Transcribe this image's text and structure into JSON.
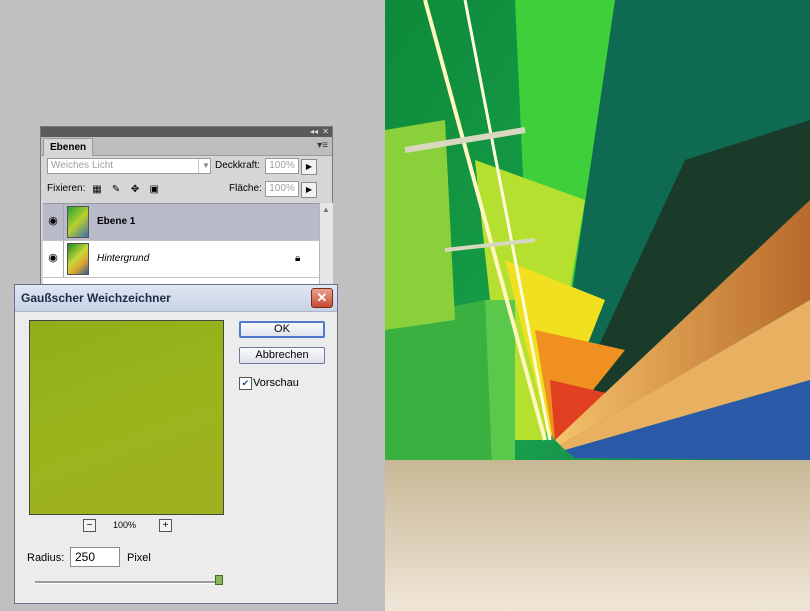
{
  "layers_panel": {
    "tab": "Ebenen",
    "menu_icon": "panel-menu-icon",
    "blend_mode": "Weiches Licht",
    "opacity_label": "Deckkraft:",
    "opacity_value": "100%",
    "lock_label": "Fixieren:",
    "fill_label": "Fläche:",
    "fill_value": "100%",
    "layers": [
      {
        "name": "Ebene 1",
        "selected": true,
        "locked": false
      },
      {
        "name": "Hintergrund",
        "selected": false,
        "locked": true
      }
    ]
  },
  "dialog": {
    "title": "Gaußscher Weichzeichner",
    "ok": "OK",
    "cancel": "Abbrechen",
    "preview_label": "Vorschau",
    "preview_checked": true,
    "zoom": "100%",
    "radius_label": "Radius:",
    "radius_value": "250",
    "radius_unit": "Pixel",
    "slider_level": 0.99
  },
  "colors": {
    "preview_green": "#99b41c",
    "selected_layer": "#b9bac9",
    "close_red": "#c64a33"
  }
}
